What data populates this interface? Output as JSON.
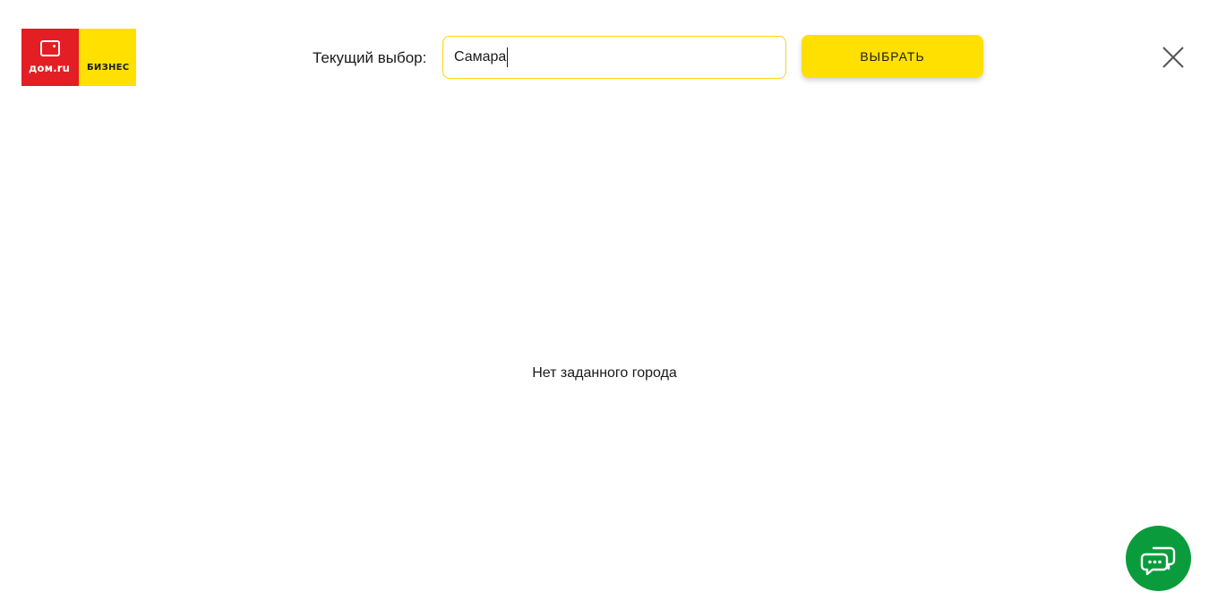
{
  "logo": {
    "brand_text": "дом.ru",
    "segment_text": "БИЗНЕС",
    "brand_color": "#e31e24",
    "segment_color": "#ffe000"
  },
  "city_selector": {
    "label": "Текущий выбор:",
    "input_value": "Самара",
    "choose_button_label": "ВЫБРАТЬ",
    "close_icon": "close-icon"
  },
  "results": {
    "empty_message": "Нет заданного города"
  },
  "chat_widget": {
    "icon": "chat-icon",
    "color": "#0a9c3c"
  }
}
